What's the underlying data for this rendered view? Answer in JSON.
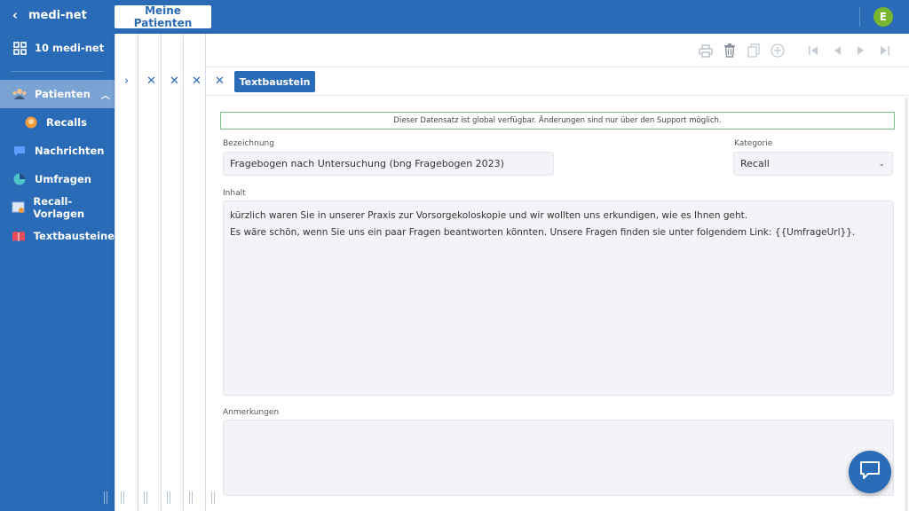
{
  "header": {
    "back_label": "medi-net",
    "tab_label": "Meine Patienten",
    "avatar_letter": "E"
  },
  "sidebar": {
    "items": [
      {
        "label": "10 medi-net",
        "icon": "grid-icon"
      },
      {
        "label": "Patienten",
        "icon": "patients-icon",
        "active": true
      },
      {
        "label": "Recalls",
        "icon": "recall-person-icon"
      },
      {
        "label": "Nachrichten",
        "icon": "message-icon"
      },
      {
        "label": "Umfragen",
        "icon": "pie-chart-icon"
      },
      {
        "label": "Recall-Vorlagen",
        "icon": "template-icon"
      },
      {
        "label": "Textbausteine",
        "icon": "book-icon"
      }
    ]
  },
  "panel": {
    "tab_label": "Textbaustein",
    "notice": "Dieser Datensatz ist global verfügbar. Änderungen sind nur über den Support möglich.",
    "bezeichnung_label": "Bezeichnung",
    "bezeichnung_value": "Fragebogen nach Untersuchung (bng Fragebogen 2023)",
    "kategorie_label": "Kategorie",
    "kategorie_value": "Recall",
    "inhalt_label": "Inhalt",
    "inhalt_line1": "kürzlich waren Sie in unserer Praxis zur Vorsorgekoloskopie und wir wollten uns erkundigen, wie es Ihnen geht.",
    "inhalt_line2": "Es wäre schön, wenn Sie uns ein paar Fragen beantworten könnten. Unsere Fragen finden sie unter folgendem Link: {{UmfrageUrl}}.",
    "anmerkungen_label": "Anmerkungen",
    "anmerkungen_value": ""
  },
  "colors": {
    "brand": "#2a6bb8",
    "sidebar_active": "#7aa3d4",
    "avatar": "#78b52f",
    "notice_border": "#7cc47f"
  }
}
